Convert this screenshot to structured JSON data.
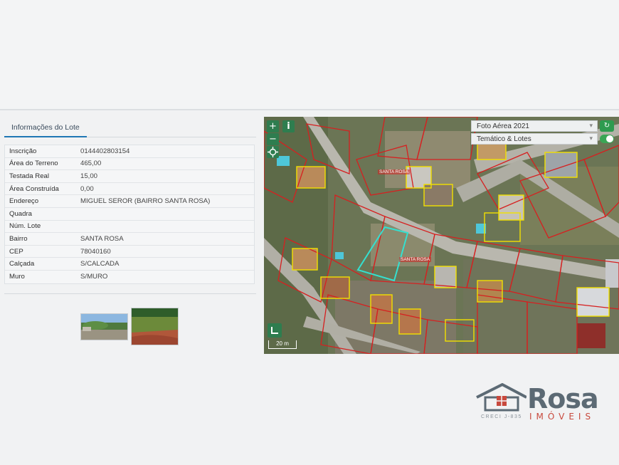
{
  "tab": {
    "label": "Informações do Lote"
  },
  "fields": [
    {
      "label": "Inscrição",
      "value": "0144402803154"
    },
    {
      "label": "Área do Terreno",
      "value": "465,00"
    },
    {
      "label": "Testada Real",
      "value": "15,00"
    },
    {
      "label": "Área Construída",
      "value": "0,00"
    },
    {
      "label": "Endereço",
      "value": "MIGUEL SEROR (BAIRRO SANTA ROSA)"
    },
    {
      "label": "Quadra",
      "value": ""
    },
    {
      "label": "Núm. Lote",
      "value": ""
    },
    {
      "label": "Bairro",
      "value": "SANTA ROSA"
    },
    {
      "label": "CEP",
      "value": "78040160"
    },
    {
      "label": "Calçada",
      "value": "S/CALCADA"
    },
    {
      "label": "Muro",
      "value": "S/MURO"
    }
  ],
  "map": {
    "layer_select": "Foto Aérea 2021",
    "theme_select": "Temático & Lotes",
    "scale_label": "20 m",
    "zoom_in": "+",
    "zoom_out": "−",
    "info_symbol": "i",
    "refresh_symbol": "↻",
    "labels": {
      "santa_rosa_1": "SANTA ROSA",
      "santa_rosa_2": "SANTA ROSA"
    }
  },
  "logo": {
    "name": "Rosa",
    "sub": "IMÓVEIS",
    "creci": "CRECI J-835"
  },
  "colors": {
    "accent": "#1f77b4",
    "map_control": "#2e7d4f",
    "lot_outline_red": "#d62020",
    "lot_outline_yellow": "#f2e000",
    "selected_lot": "#34e0d0",
    "logo_gray": "#5c6a74",
    "logo_red": "#c8493d"
  }
}
